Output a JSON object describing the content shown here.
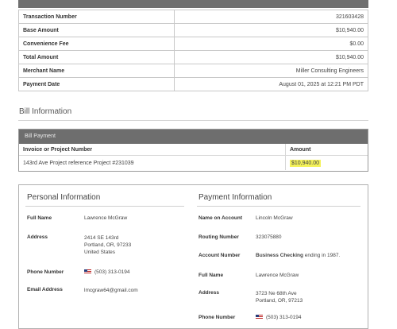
{
  "transaction": [
    {
      "label": "Transaction Number",
      "value": "321603428"
    },
    {
      "label": "Base Amount",
      "value": "$10,940.00"
    },
    {
      "label": "Convenience Fee",
      "value": "$0.00"
    },
    {
      "label": "Total Amount",
      "value": "$10,940.00"
    },
    {
      "label": "Merchant Name",
      "value": "Miller Consulting Engineers"
    },
    {
      "label": "Payment Date",
      "value": "August 01, 2025 at 12:21 PM PDT"
    }
  ],
  "bill": {
    "section_title": "Bill Information",
    "panel_title": "Bill Payment",
    "col_invoice": "Invoice or Project Number",
    "col_amount": "Amount",
    "invoice": "143rd Ave Project reference Project #231039",
    "amount": "$10,940.00"
  },
  "personal": {
    "title": "Personal Information",
    "full_name_label": "Full Name",
    "full_name": "Lawrence McGraw",
    "address_label": "Address",
    "address_line1": "2414 SE 143rd",
    "address_line2": "Portland, OR, 97233",
    "address_line3": "United States",
    "phone_label": "Phone Number",
    "phone": "(503) 313-0194",
    "email_label": "Email Address",
    "email": "lmcgraw64@gmail.com"
  },
  "payment": {
    "title": "Payment Information",
    "name_label": "Name on Account",
    "name": "Lincoln McGraw",
    "routing_label": "Routing Number",
    "routing": "323075880",
    "account_label": "Account Number",
    "account_type": "Business Checking",
    "account_suffix": "ending in 1987.",
    "full_name_label": "Full Name",
    "full_name": "Lawrence McGraw",
    "address_label": "Address",
    "address_line1": "3723 Ne 68th Ave",
    "address_line2": "Portland, OR, 97213",
    "phone_label": "Phone Number",
    "phone": "(503) 313-0194"
  }
}
